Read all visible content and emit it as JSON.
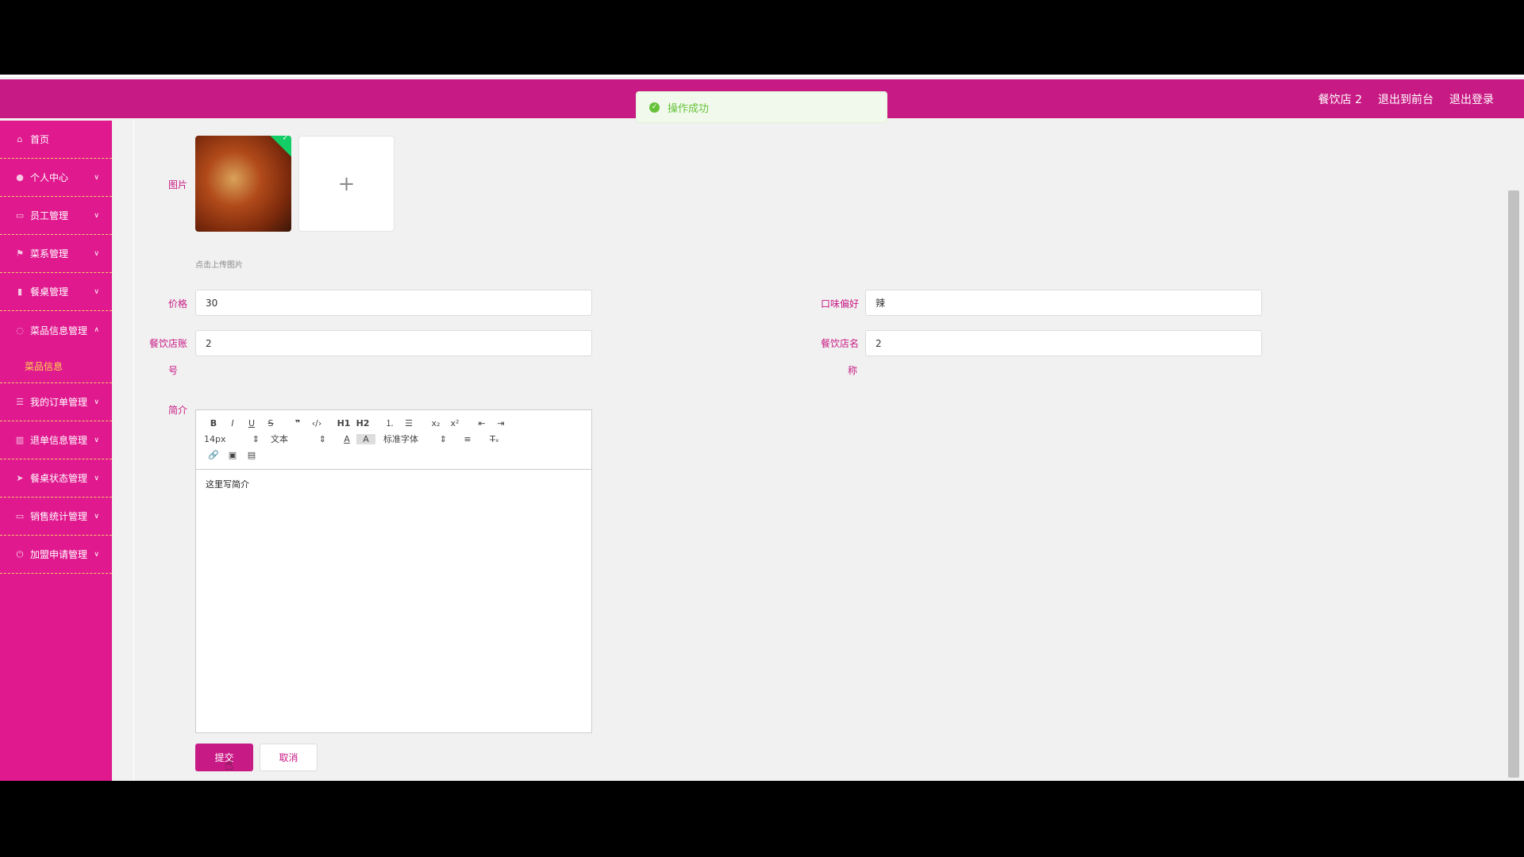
{
  "header": {
    "user": "餐饮店 2",
    "front_link": "退出到前台",
    "logout": "退出登录"
  },
  "toast": {
    "message": "操作成功",
    "icon": "check-circle-icon"
  },
  "sidebar": {
    "items": [
      {
        "label": "首页",
        "icon": "home-icon"
      },
      {
        "label": "个人中心",
        "icon": "user-icon"
      },
      {
        "label": "员工管理",
        "icon": "card-icon"
      },
      {
        "label": "菜系管理",
        "icon": "flag-icon"
      },
      {
        "label": "餐桌管理",
        "icon": "clipboard-icon"
      },
      {
        "label": "菜品信息管理",
        "icon": "bell-icon"
      },
      {
        "label": "我的订单管理",
        "icon": "list-icon"
      },
      {
        "label": "退单信息管理",
        "icon": "bar-chart-icon"
      },
      {
        "label": "餐桌状态管理",
        "icon": "send-icon"
      },
      {
        "label": "销售统计管理",
        "icon": "card-icon"
      },
      {
        "label": "加盟申请管理",
        "icon": "power-icon"
      }
    ],
    "sub_item": "菜品信息"
  },
  "form": {
    "image_label": "图片",
    "upload_tip": "点击上传图片",
    "price_label": "价格",
    "price_value": "30",
    "taste_label": "口味偏好",
    "taste_value": "辣",
    "shop_account_label_1": "餐饮店账",
    "shop_account_label_2": "号",
    "shop_account_value": "2",
    "shop_name_label_1": "餐饮店名",
    "shop_name_label_2": "称",
    "shop_name_value": "2",
    "intro_label": "简介",
    "intro_content": "这里写简介",
    "submit": "提交",
    "cancel": "取消"
  },
  "editor": {
    "size": "14px",
    "text_style": "文本",
    "font": "标准字体",
    "btn_h1": "H1",
    "btn_h2": "H2"
  },
  "colors": {
    "topbar": "#c81a84",
    "sidebar": "#e0198f",
    "accent": "#c81a84",
    "submenu_active": "#ffd54f",
    "toast_bg": "#f0f9eb",
    "toast_text": "#67c23a"
  }
}
